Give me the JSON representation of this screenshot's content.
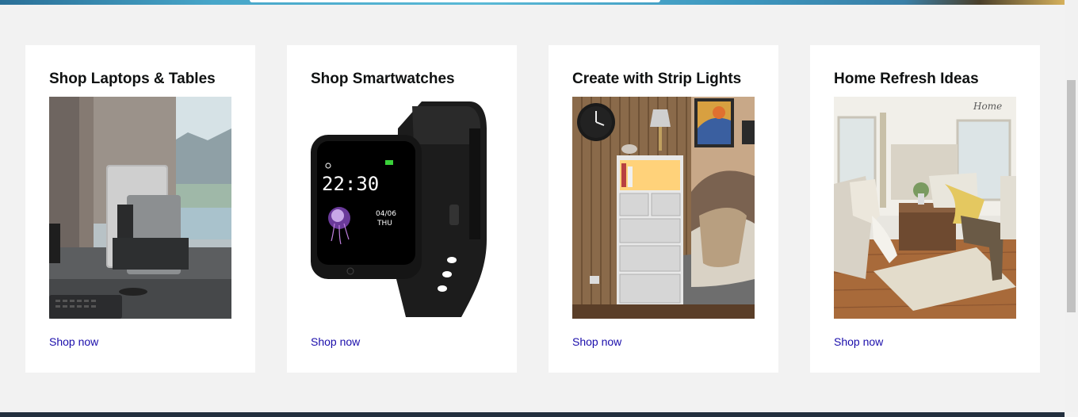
{
  "cards": [
    {
      "title": "Shop Laptops & Tables",
      "link": "Shop now",
      "image": "laptop-stand-photo"
    },
    {
      "title": "Shop Smartwatches",
      "link": "Shop now",
      "image": "smartwatch-photo"
    },
    {
      "title": "Create with Strip Lights",
      "link": "Shop now",
      "image": "strip-lights-bedroom-photo"
    },
    {
      "title": "Home Refresh Ideas",
      "link": "Shop now",
      "image": "living-room-photo"
    }
  ],
  "watch_face": {
    "time": "22:30",
    "date": "04/06",
    "day": "THU"
  },
  "wall_sign": "Home",
  "colors": {
    "page_bg": "#f2f2f2",
    "card_bg": "#ffffff",
    "link": "#1a0dab",
    "footer": "#232f3e"
  }
}
